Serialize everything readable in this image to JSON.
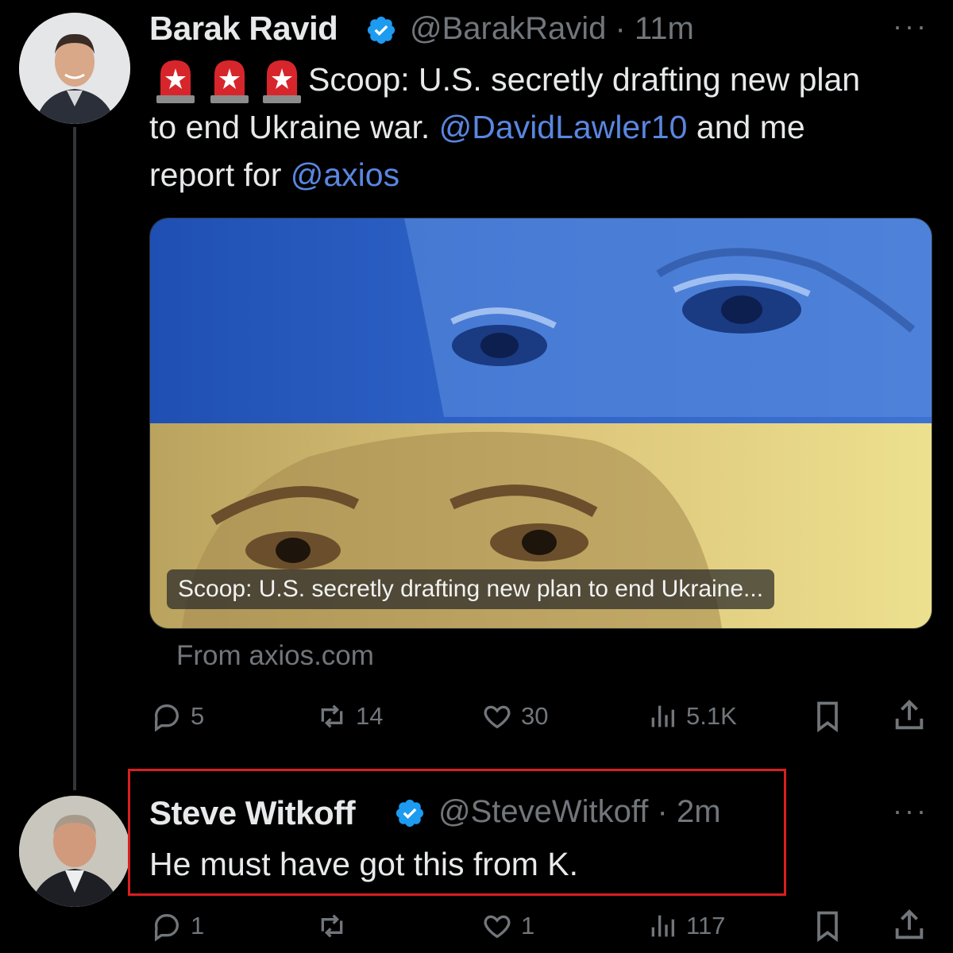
{
  "tweet1": {
    "name": "Barak Ravid",
    "handle": "@BarakRavid",
    "sep": "·",
    "time": "11m",
    "more": "···",
    "text_line1": "Scoop: U.S. secretly drafting new plan",
    "text_line2_pre": "to end Ukraine war.",
    "mention1": "@DavidLawler10",
    "text_line2_post": "and me",
    "text_line3_pre": "report for",
    "mention2": "@axios",
    "card_caption": "Scoop: U.S. secretly drafting new plan to end Ukraine...",
    "card_source": "From axios.com",
    "replies": "5",
    "reposts": "14",
    "likes": "30",
    "views": "5.1K"
  },
  "tweet2": {
    "name": "Steve Witkoff",
    "handle": "@SteveWitkoff",
    "sep": "·",
    "time": "2m",
    "more": "···",
    "text": "He must have got this from K.",
    "replies": "1",
    "reposts": "",
    "likes": "1",
    "views": "117"
  },
  "colors": {
    "background": "#000000",
    "text": "#e7e9ea",
    "muted": "#71767b",
    "link": "#5a86e0",
    "verified": "#1d9bf0",
    "highlight": "#d81f1f",
    "flag_blue": "#2e5ec4",
    "flag_yellow": "#e6d27a"
  },
  "icons": [
    "verified-badge-icon",
    "siren-icon",
    "reply-icon",
    "repost-icon",
    "like-icon",
    "views-icon",
    "bookmark-icon",
    "share-icon",
    "more-icon"
  ]
}
